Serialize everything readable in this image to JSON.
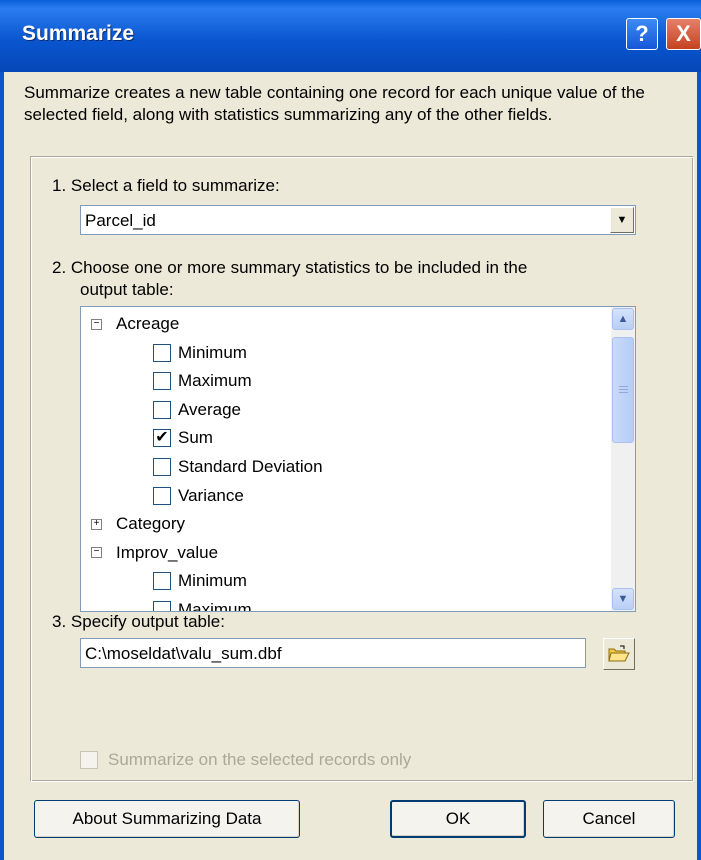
{
  "window": {
    "title": "Summarize",
    "help_button": "?",
    "close_button": "X"
  },
  "description": "Summarize creates a new table containing one record for each unique value of the selected field, along with statistics summarizing any of the other fields.",
  "step1": {
    "label": "1.  Select a field to summarize:",
    "selected_field": "Parcel_id"
  },
  "step2": {
    "label_line1": "2.  Choose one or more summary statistics to be included in the",
    "label_line2": "output table:",
    "tree": [
      {
        "type": "group",
        "label": "Acreage",
        "expanded": true,
        "expander": "−"
      },
      {
        "type": "stat",
        "label": "Minimum",
        "checked": false
      },
      {
        "type": "stat",
        "label": "Maximum",
        "checked": false
      },
      {
        "type": "stat",
        "label": "Average",
        "checked": false
      },
      {
        "type": "stat",
        "label": "Sum",
        "checked": true
      },
      {
        "type": "stat",
        "label": "Standard Deviation",
        "checked": false
      },
      {
        "type": "stat",
        "label": "Variance",
        "checked": false
      },
      {
        "type": "group",
        "label": "Category",
        "expanded": false,
        "expander": "+"
      },
      {
        "type": "group",
        "label": "Improv_value",
        "expanded": true,
        "expander": "−"
      },
      {
        "type": "stat",
        "label": "Minimum",
        "checked": false
      },
      {
        "type": "stat",
        "label": "Maximum",
        "checked": false
      }
    ]
  },
  "step3": {
    "label": "3.  Specify output table:",
    "output_path": "C:\\moseldat\\valu_sum.dbf"
  },
  "selected_only": {
    "label": "Summarize on the selected records only",
    "checked": false,
    "enabled": false
  },
  "buttons": {
    "about": "About Summarizing Data",
    "ok": "OK",
    "cancel": "Cancel"
  },
  "colors": {
    "titlebar": "#0a56d0",
    "dialog_bg": "#ece9d8",
    "disabled_text": "#aca899"
  }
}
